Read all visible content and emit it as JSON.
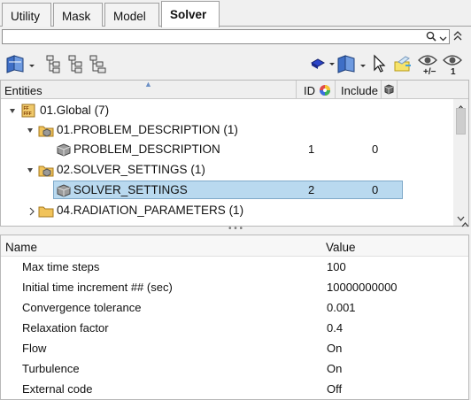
{
  "tabs": [
    {
      "label": "Utility",
      "active": false
    },
    {
      "label": "Mask",
      "active": false
    },
    {
      "label": "Model",
      "active": false
    },
    {
      "label": "Solver",
      "active": true
    }
  ],
  "search": {
    "value": "",
    "placeholder": ""
  },
  "toolbar": {
    "icons": [
      "entity-view-icon",
      "tree-expand-icon",
      "tree-collapse-icon",
      "tree-filter-icon",
      "display-mode-icon",
      "entity-view-right-icon",
      "select-cursor-icon",
      "clipboard-highlight-icon",
      "visibility-toggle-icon",
      "visibility-one-icon"
    ]
  },
  "tree": {
    "headers": {
      "entities": "Entities",
      "id": "ID",
      "include": "Include"
    },
    "rows": [
      {
        "label": "01.Global",
        "count": "(7)",
        "id": "",
        "include": "",
        "level": 0,
        "kind": "global",
        "selected": false
      },
      {
        "label": "01.PROBLEM_DESCRIPTION",
        "count": "(1)",
        "id": "",
        "include": "",
        "level": 1,
        "kind": "folder",
        "selected": false
      },
      {
        "label": "PROBLEM_DESCRIPTION",
        "count": "",
        "id": "1",
        "include": "0",
        "level": 2,
        "kind": "entity",
        "selected": false
      },
      {
        "label": "02.SOLVER_SETTINGS",
        "count": "(1)",
        "id": "",
        "include": "",
        "level": 1,
        "kind": "folder",
        "selected": false
      },
      {
        "label": "SOLVER_SETTINGS",
        "count": "",
        "id": "2",
        "include": "0",
        "level": 2,
        "kind": "entity",
        "selected": true
      },
      {
        "label": "04.RADIATION_PARAMETERS",
        "count": "(1)",
        "id": "",
        "include": "",
        "level": 1,
        "kind": "folder",
        "selected": false
      }
    ]
  },
  "splitter": {
    "dots": "• • •"
  },
  "properties": {
    "headers": {
      "name": "Name",
      "value": "Value"
    },
    "rows": [
      {
        "name": "Max time steps",
        "value": "100"
      },
      {
        "name": "Initial time increment ## (sec)",
        "value": "10000000000"
      },
      {
        "name": "Convergence tolerance",
        "value": "0.001"
      },
      {
        "name": "Relaxation factor",
        "value": "0.4"
      },
      {
        "name": "Flow",
        "value": "On"
      },
      {
        "name": "Turbulence",
        "value": "On"
      },
      {
        "name": "External code",
        "value": "Off"
      }
    ]
  },
  "colors": {
    "selection": "#b9d9ef",
    "folder": "#e8b84a",
    "accent": "#2a5fb0"
  }
}
